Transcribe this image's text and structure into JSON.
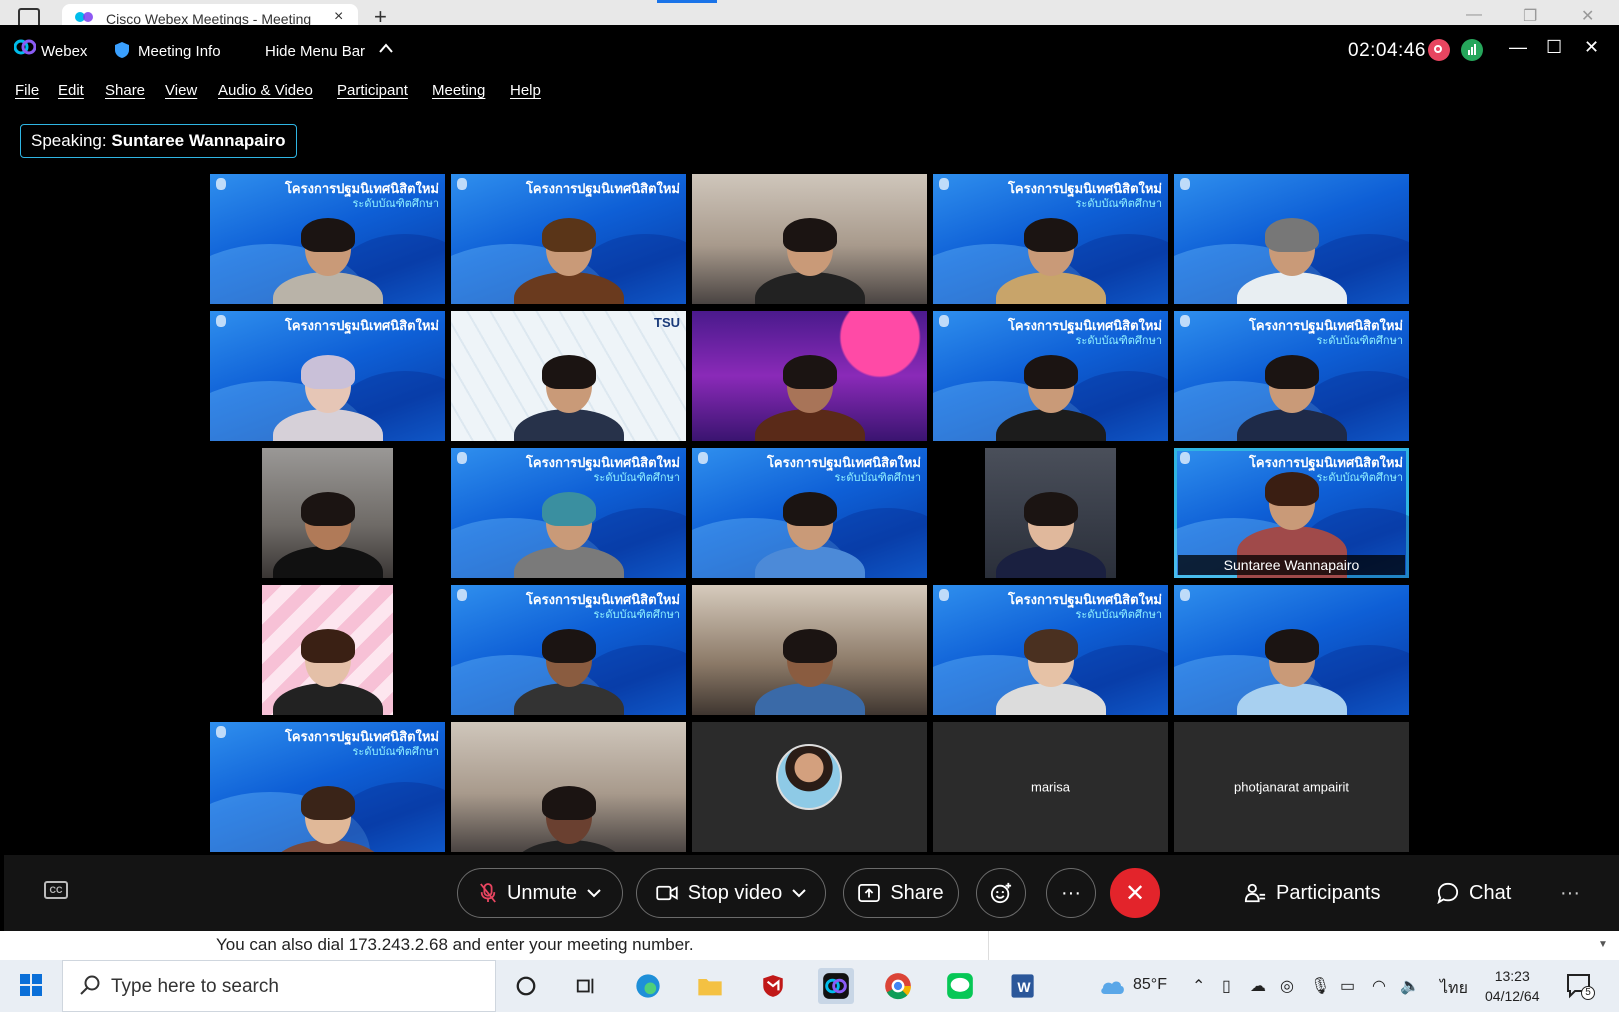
{
  "browser": {
    "tab_title": "Cisco Webex Meetings - Meeting",
    "tab_close": "×",
    "new_tab": "+"
  },
  "titlebar": {
    "app_name": "Webex",
    "meeting_info": "Meeting Info",
    "hide_menu_bar": "Hide Menu Bar",
    "timer": "02:04:46",
    "minimize": "—",
    "maximize": "☐",
    "close": "✕"
  },
  "menu": {
    "items": [
      "File",
      "Edit",
      "Share",
      "View",
      "Audio & Video",
      "Participant",
      "Meeting",
      "Help"
    ]
  },
  "speaking": {
    "prefix": "Speaking:",
    "name": "Suntaree Wannapairo"
  },
  "grid": {
    "banner_text": "โครงการปฐมนิเทศนิสิตใหม่",
    "banner_sub": "ระดับบัณฑิตศึกษา",
    "tsu_label": "TSU",
    "active_speaker_name": "Suntaree Wannapairo",
    "name_only_tiles": [
      "marisa",
      "photjanarat ampairit"
    ]
  },
  "controls": {
    "cc_label": "CC",
    "unmute": "Unmute",
    "stop_video": "Stop video",
    "share": "Share",
    "more": "···",
    "end": "✕",
    "participants": "Participants",
    "chat": "Chat",
    "overflow": "···"
  },
  "page": {
    "dial_text": "You can also dial 173.243.2.68 and enter your meeting number."
  },
  "taskbar": {
    "search_placeholder": "Type here to search",
    "weather": "85°F",
    "language": "ไทย",
    "time": "13:23",
    "date": "04/12/64",
    "notification_count": "5"
  },
  "colors": {
    "accent": "#2fb5e3",
    "end_call": "#e3242b",
    "record": "#e84560",
    "network": "#26a65b"
  }
}
